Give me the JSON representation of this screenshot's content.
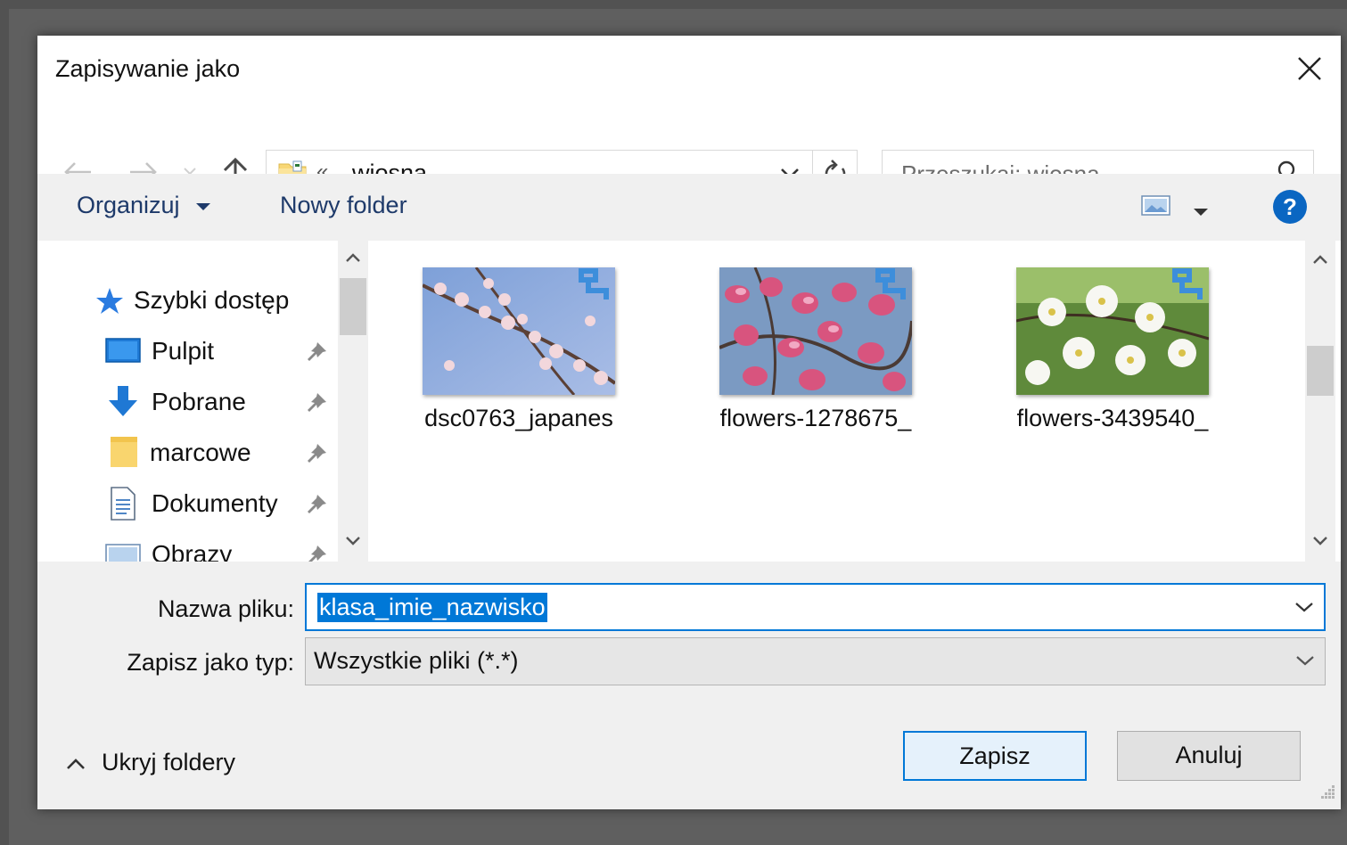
{
  "dialog": {
    "title": "Zapisywanie jako"
  },
  "navigation": {
    "address_chevrons": "«",
    "current_folder": "wiosna",
    "search_placeholder": "Przeszukaj: wiosna"
  },
  "toolbar": {
    "organize_label": "Organizuj",
    "new_folder_label": "Nowy folder"
  },
  "sidebar": {
    "items": [
      {
        "label": "Szybki dostęp",
        "icon": "star-icon",
        "pinned": false
      },
      {
        "label": "Pulpit",
        "icon": "desktop-icon",
        "pinned": true
      },
      {
        "label": "Pobrane",
        "icon": "download-icon",
        "pinned": true
      },
      {
        "label": "marcowe",
        "icon": "folder-icon",
        "pinned": true
      },
      {
        "label": "Dokumenty",
        "icon": "document-icon",
        "pinned": true
      },
      {
        "label": "Obrazy",
        "icon": "pictures-icon",
        "pinned": true
      }
    ]
  },
  "files": [
    {
      "name": "dsc0763_japanes",
      "thumbnail": "blossom-blue-sky"
    },
    {
      "name": "flowers-1278675_",
      "thumbnail": "pink-magnolia"
    },
    {
      "name": "flowers-3439540_",
      "thumbnail": "white-cherry-flowers"
    }
  ],
  "form": {
    "filename_label": "Nazwa pliku:",
    "filename_value": "klasa_imie_nazwisko",
    "filetype_label": "Zapisz jako typ:",
    "filetype_value": "Wszystkie pliki (*.*)"
  },
  "footer": {
    "hide_folders_label": "Ukryj foldery",
    "save_label": "Zapisz",
    "cancel_label": "Anuluj"
  },
  "colors": {
    "accent": "#0078d7",
    "help": "#0a66c2"
  }
}
